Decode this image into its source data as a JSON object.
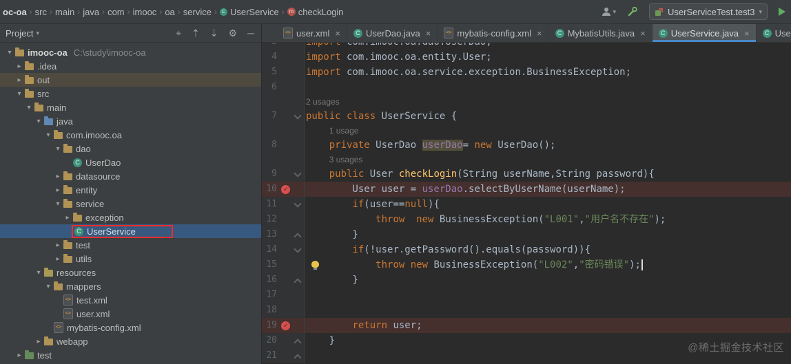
{
  "breadcrumb": {
    "items": [
      {
        "label": "oc-oa",
        "bold": true
      },
      {
        "label": "src"
      },
      {
        "label": "main"
      },
      {
        "label": "java"
      },
      {
        "label": "com"
      },
      {
        "label": "imooc"
      },
      {
        "label": "oa"
      },
      {
        "label": "service"
      },
      {
        "label": "UserService",
        "icon": "class"
      },
      {
        "label": "checkLogin",
        "icon": "method"
      }
    ]
  },
  "toolbar": {
    "run_config": "UserServiceTest.test3"
  },
  "project_panel": {
    "title": "Project",
    "header_icons": [
      "locate",
      "expand-all",
      "collapse-all",
      "settings",
      "hide"
    ],
    "tree": [
      {
        "label": "imooc-oa",
        "path": "C:\\study\\imooc-oa",
        "depth": 0,
        "icon": "folder",
        "chevron": "down",
        "bold": true
      },
      {
        "label": ".idea",
        "depth": 1,
        "icon": "folder",
        "chevron": "right"
      },
      {
        "label": "out",
        "depth": 1,
        "icon": "folder",
        "chevron": "right",
        "row_highlight": true
      },
      {
        "label": "src",
        "depth": 1,
        "icon": "folder",
        "chevron": "down"
      },
      {
        "label": "main",
        "depth": 2,
        "icon": "folder",
        "chevron": "down"
      },
      {
        "label": "java",
        "depth": 3,
        "icon": "folder-src",
        "chevron": "down"
      },
      {
        "label": "com.imooc.oa",
        "depth": 4,
        "icon": "folder",
        "chevron": "down"
      },
      {
        "label": "dao",
        "depth": 5,
        "icon": "folder",
        "chevron": "down"
      },
      {
        "label": "UserDao",
        "depth": 6,
        "icon": "class"
      },
      {
        "label": "datasource",
        "depth": 5,
        "icon": "folder",
        "chevron": "right"
      },
      {
        "label": "entity",
        "depth": 5,
        "icon": "folder",
        "chevron": "right"
      },
      {
        "label": "service",
        "depth": 5,
        "icon": "folder",
        "chevron": "down"
      },
      {
        "label": "exception",
        "depth": 6,
        "icon": "folder",
        "chevron": "right"
      },
      {
        "label": "UserService",
        "depth": 6,
        "icon": "class",
        "selected": true,
        "red_box": true
      },
      {
        "label": "test",
        "depth": 5,
        "icon": "folder",
        "chevron": "right"
      },
      {
        "label": "utils",
        "depth": 5,
        "icon": "folder",
        "chevron": "right"
      },
      {
        "label": "resources",
        "depth": 3,
        "icon": "folder-res",
        "chevron": "down"
      },
      {
        "label": "mappers",
        "depth": 4,
        "icon": "folder",
        "chevron": "down"
      },
      {
        "label": "test.xml",
        "depth": 5,
        "icon": "xml"
      },
      {
        "label": "user.xml",
        "depth": 5,
        "icon": "xml"
      },
      {
        "label": "mybatis-config.xml",
        "depth": 4,
        "icon": "xml"
      },
      {
        "label": "webapp",
        "depth": 3,
        "icon": "folder",
        "chevron": "right"
      },
      {
        "label": "test",
        "depth": 1,
        "icon": "folder-test",
        "chevron": "right"
      }
    ]
  },
  "tabs": [
    {
      "label": "user.xml",
      "icon": "xml"
    },
    {
      "label": "UserDao.java",
      "icon": "class"
    },
    {
      "label": "mybatis-config.xml",
      "icon": "xml"
    },
    {
      "label": "MybatisUtils.java",
      "icon": "class"
    },
    {
      "label": "UserService.java",
      "icon": "class",
      "active": true
    },
    {
      "label": "UserSer",
      "icon": "class",
      "clipped": true
    }
  ],
  "editor": {
    "rows": [
      {
        "n": 3,
        "seg": [
          [
            "k",
            "import"
          ],
          [
            "t",
            " com.imooc.oa.dao.UserDao;"
          ]
        ]
      },
      {
        "n": 4,
        "seg": [
          [
            "k",
            "import"
          ],
          [
            "t",
            " com.imooc.oa.entity.User;"
          ]
        ]
      },
      {
        "n": 5,
        "seg": [
          [
            "k",
            "import"
          ],
          [
            "t",
            " com.imooc.oa.service.exception.BusinessException;"
          ]
        ]
      },
      {
        "n": 6,
        "seg": []
      },
      {
        "hint": "2 usages",
        "indent": 0
      },
      {
        "n": 7,
        "fold": "start",
        "seg": [
          [
            "k",
            "public class"
          ],
          [
            "t",
            " UserService {"
          ]
        ]
      },
      {
        "hint": "1 usage",
        "indent": 4
      },
      {
        "n": 8,
        "seg": [
          [
            "t",
            "    "
          ],
          [
            "k",
            "private"
          ],
          [
            "t",
            " UserDao "
          ],
          [
            "fh",
            "userDao"
          ],
          [
            "t",
            "= "
          ],
          [
            "k",
            "new"
          ],
          [
            "t",
            " UserDao();"
          ]
        ]
      },
      {
        "hint": "3 usages",
        "indent": 4
      },
      {
        "n": 9,
        "fold": "start",
        "seg": [
          [
            "t",
            "    "
          ],
          [
            "k",
            "public"
          ],
          [
            "t",
            " User "
          ],
          [
            "m",
            "checkLogin"
          ],
          [
            "t",
            "(String userName,String password){"
          ]
        ]
      },
      {
        "n": 10,
        "bp": true,
        "gutter": "breakpoint",
        "seg": [
          [
            "t",
            "        User user = "
          ],
          [
            "f",
            "userDao"
          ],
          [
            "t",
            ".selectByUserName(userName);"
          ]
        ]
      },
      {
        "n": 11,
        "fold": "start",
        "seg": [
          [
            "t",
            "        "
          ],
          [
            "k",
            "if"
          ],
          [
            "t",
            "(user=="
          ],
          [
            "k",
            "null"
          ],
          [
            "t",
            "){"
          ]
        ]
      },
      {
        "n": 12,
        "seg": [
          [
            "t",
            "            "
          ],
          [
            "k",
            "throw"
          ],
          [
            "t",
            "  "
          ],
          [
            "k",
            "new"
          ],
          [
            "t",
            " BusinessException("
          ],
          [
            "s",
            "\"L001\""
          ],
          [
            "t",
            ","
          ],
          [
            "s",
            "\"用户名不存在\""
          ],
          [
            "t",
            ");"
          ]
        ]
      },
      {
        "n": 13,
        "fold": "end",
        "seg": [
          [
            "t",
            "        }"
          ]
        ]
      },
      {
        "n": 14,
        "fold": "start",
        "seg": [
          [
            "t",
            "        "
          ],
          [
            "k",
            "if"
          ],
          [
            "t",
            "(!user.getPassword().equals(password)){"
          ]
        ]
      },
      {
        "n": 15,
        "gutter": "bulb",
        "caret": true,
        "seg": [
          [
            "t",
            "            "
          ],
          [
            "k",
            "throw"
          ],
          [
            "t",
            " "
          ],
          [
            "k",
            "new"
          ],
          [
            "t",
            " BusinessException("
          ],
          [
            "s",
            "\"L002\""
          ],
          [
            "t",
            ","
          ],
          [
            "s",
            "\"密码错误\""
          ],
          [
            "t",
            ");"
          ]
        ]
      },
      {
        "n": 16,
        "fold": "end",
        "seg": [
          [
            "t",
            "        }"
          ]
        ]
      },
      {
        "n": 17,
        "seg": []
      },
      {
        "n": 18,
        "seg": []
      },
      {
        "n": 19,
        "bp": true,
        "gutter": "breakpoint",
        "seg": [
          [
            "t",
            "        "
          ],
          [
            "k",
            "return"
          ],
          [
            "t",
            " user;"
          ]
        ]
      },
      {
        "n": 20,
        "fold": "end",
        "seg": [
          [
            "t",
            "    }"
          ]
        ]
      },
      {
        "n": 21,
        "fold": "end",
        "seg": []
      }
    ]
  },
  "watermark": "@稀土掘金技术社区"
}
